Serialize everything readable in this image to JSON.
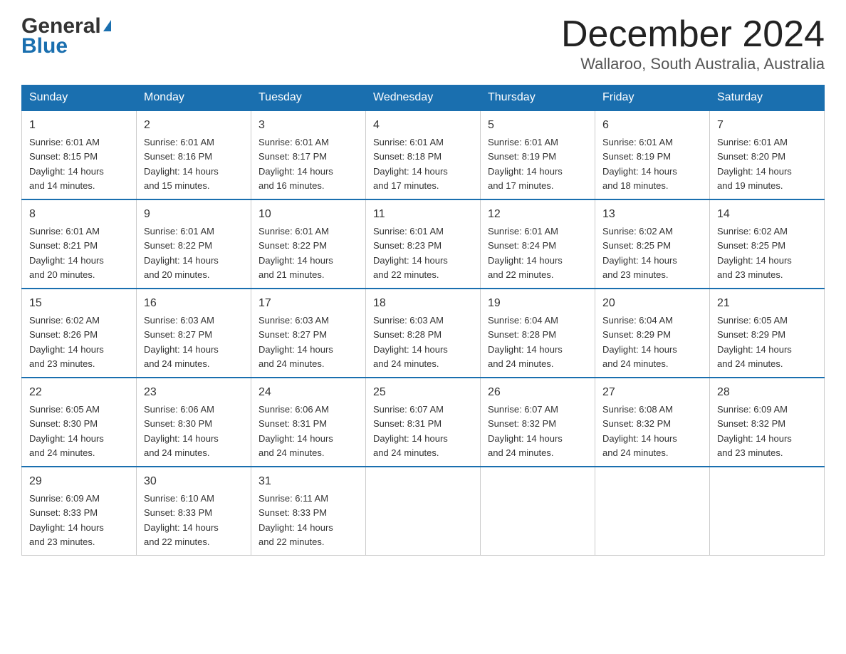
{
  "header": {
    "logo_general": "General",
    "logo_blue": "Blue",
    "month_title": "December 2024",
    "location": "Wallaroo, South Australia, Australia"
  },
  "days_of_week": [
    "Sunday",
    "Monday",
    "Tuesday",
    "Wednesday",
    "Thursday",
    "Friday",
    "Saturday"
  ],
  "weeks": [
    [
      {
        "day": "1",
        "sunrise": "6:01 AM",
        "sunset": "8:15 PM",
        "daylight": "14 hours and 14 minutes."
      },
      {
        "day": "2",
        "sunrise": "6:01 AM",
        "sunset": "8:16 PM",
        "daylight": "14 hours and 15 minutes."
      },
      {
        "day": "3",
        "sunrise": "6:01 AM",
        "sunset": "8:17 PM",
        "daylight": "14 hours and 16 minutes."
      },
      {
        "day": "4",
        "sunrise": "6:01 AM",
        "sunset": "8:18 PM",
        "daylight": "14 hours and 17 minutes."
      },
      {
        "day": "5",
        "sunrise": "6:01 AM",
        "sunset": "8:19 PM",
        "daylight": "14 hours and 17 minutes."
      },
      {
        "day": "6",
        "sunrise": "6:01 AM",
        "sunset": "8:19 PM",
        "daylight": "14 hours and 18 minutes."
      },
      {
        "day": "7",
        "sunrise": "6:01 AM",
        "sunset": "8:20 PM",
        "daylight": "14 hours and 19 minutes."
      }
    ],
    [
      {
        "day": "8",
        "sunrise": "6:01 AM",
        "sunset": "8:21 PM",
        "daylight": "14 hours and 20 minutes."
      },
      {
        "day": "9",
        "sunrise": "6:01 AM",
        "sunset": "8:22 PM",
        "daylight": "14 hours and 20 minutes."
      },
      {
        "day": "10",
        "sunrise": "6:01 AM",
        "sunset": "8:22 PM",
        "daylight": "14 hours and 21 minutes."
      },
      {
        "day": "11",
        "sunrise": "6:01 AM",
        "sunset": "8:23 PM",
        "daylight": "14 hours and 22 minutes."
      },
      {
        "day": "12",
        "sunrise": "6:01 AM",
        "sunset": "8:24 PM",
        "daylight": "14 hours and 22 minutes."
      },
      {
        "day": "13",
        "sunrise": "6:02 AM",
        "sunset": "8:25 PM",
        "daylight": "14 hours and 23 minutes."
      },
      {
        "day": "14",
        "sunrise": "6:02 AM",
        "sunset": "8:25 PM",
        "daylight": "14 hours and 23 minutes."
      }
    ],
    [
      {
        "day": "15",
        "sunrise": "6:02 AM",
        "sunset": "8:26 PM",
        "daylight": "14 hours and 23 minutes."
      },
      {
        "day": "16",
        "sunrise": "6:03 AM",
        "sunset": "8:27 PM",
        "daylight": "14 hours and 24 minutes."
      },
      {
        "day": "17",
        "sunrise": "6:03 AM",
        "sunset": "8:27 PM",
        "daylight": "14 hours and 24 minutes."
      },
      {
        "day": "18",
        "sunrise": "6:03 AM",
        "sunset": "8:28 PM",
        "daylight": "14 hours and 24 minutes."
      },
      {
        "day": "19",
        "sunrise": "6:04 AM",
        "sunset": "8:28 PM",
        "daylight": "14 hours and 24 minutes."
      },
      {
        "day": "20",
        "sunrise": "6:04 AM",
        "sunset": "8:29 PM",
        "daylight": "14 hours and 24 minutes."
      },
      {
        "day": "21",
        "sunrise": "6:05 AM",
        "sunset": "8:29 PM",
        "daylight": "14 hours and 24 minutes."
      }
    ],
    [
      {
        "day": "22",
        "sunrise": "6:05 AM",
        "sunset": "8:30 PM",
        "daylight": "14 hours and 24 minutes."
      },
      {
        "day": "23",
        "sunrise": "6:06 AM",
        "sunset": "8:30 PM",
        "daylight": "14 hours and 24 minutes."
      },
      {
        "day": "24",
        "sunrise": "6:06 AM",
        "sunset": "8:31 PM",
        "daylight": "14 hours and 24 minutes."
      },
      {
        "day": "25",
        "sunrise": "6:07 AM",
        "sunset": "8:31 PM",
        "daylight": "14 hours and 24 minutes."
      },
      {
        "day": "26",
        "sunrise": "6:07 AM",
        "sunset": "8:32 PM",
        "daylight": "14 hours and 24 minutes."
      },
      {
        "day": "27",
        "sunrise": "6:08 AM",
        "sunset": "8:32 PM",
        "daylight": "14 hours and 24 minutes."
      },
      {
        "day": "28",
        "sunrise": "6:09 AM",
        "sunset": "8:32 PM",
        "daylight": "14 hours and 23 minutes."
      }
    ],
    [
      {
        "day": "29",
        "sunrise": "6:09 AM",
        "sunset": "8:33 PM",
        "daylight": "14 hours and 23 minutes."
      },
      {
        "day": "30",
        "sunrise": "6:10 AM",
        "sunset": "8:33 PM",
        "daylight": "14 hours and 22 minutes."
      },
      {
        "day": "31",
        "sunrise": "6:11 AM",
        "sunset": "8:33 PM",
        "daylight": "14 hours and 22 minutes."
      },
      null,
      null,
      null,
      null
    ]
  ],
  "labels": {
    "sunrise": "Sunrise:",
    "sunset": "Sunset:",
    "daylight": "Daylight:"
  }
}
